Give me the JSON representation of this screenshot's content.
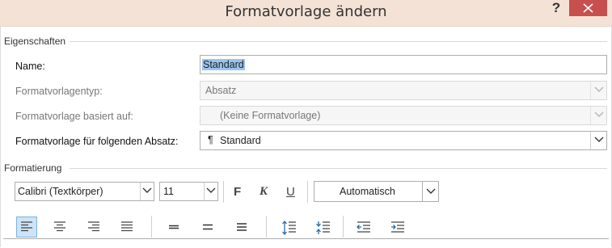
{
  "window": {
    "title": "Formatvorlage ändern",
    "help_glyph": "?",
    "close_icon": "close-icon"
  },
  "properties": {
    "section_label": "Eigenschaften",
    "name_label": "Name:",
    "name_value": "Standard",
    "type_label": "Formatvorlagentyp:",
    "type_value": "Absatz",
    "based_on_label": "Formatvorlage basiert auf:",
    "based_on_value": "(Keine Formatvorlage)",
    "next_label": "Formatvorlage für folgenden Absatz:",
    "next_pilcrow": "¶",
    "next_value": "Standard"
  },
  "formatting": {
    "section_label": "Formatierung",
    "font": "Calibri (Textkörper)",
    "size": "11",
    "bold": "F",
    "italic": "K",
    "underline": "U",
    "color": "Automatisch",
    "paragraph_buttons": [
      "align-left-icon",
      "align-center-icon",
      "align-right-icon",
      "justify-icon",
      "single-spacing-icon",
      "one-half-spacing-icon",
      "double-spacing-icon",
      "increase-paragraph-spacing-icon",
      "decrease-paragraph-spacing-icon",
      "decrease-indent-icon",
      "increase-indent-icon"
    ],
    "active_alignment": "align-left"
  }
}
